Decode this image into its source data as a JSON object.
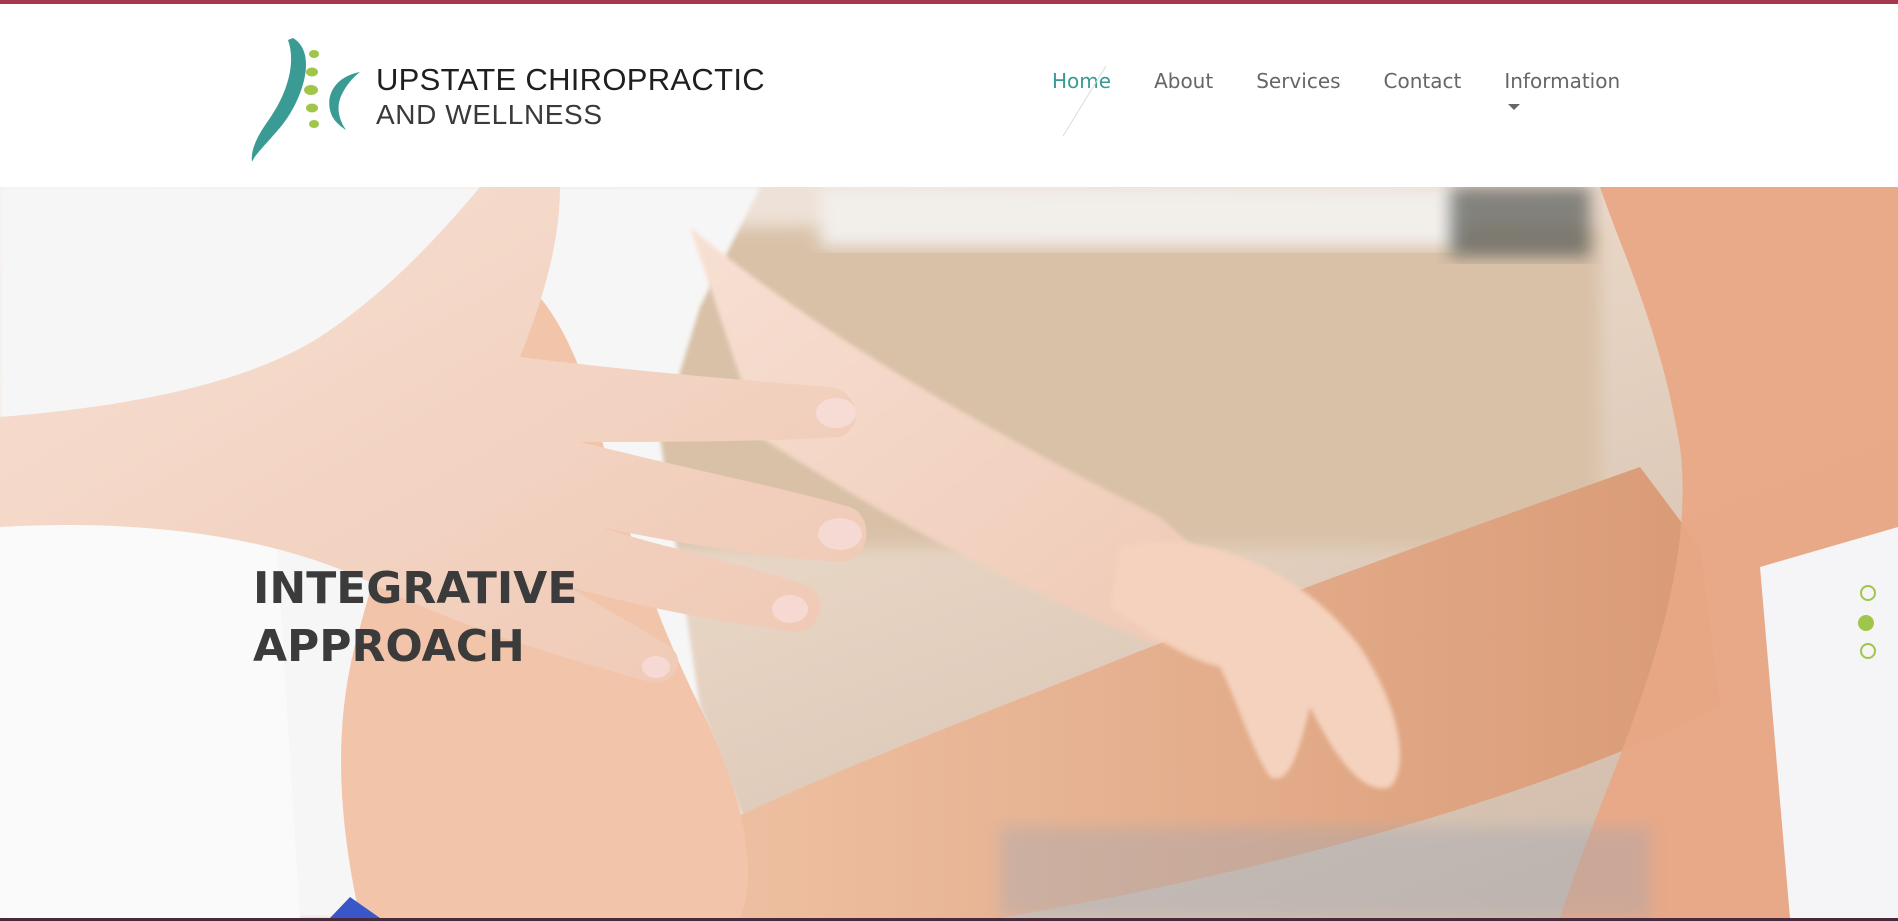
{
  "brand": {
    "line1": "UPSTATE CHIROPRACTIC",
    "line2": "AND WELLNESS",
    "teal": "#3a9a94",
    "green": "#9fc64a",
    "accent_border": "#a6374f"
  },
  "nav": {
    "items": [
      {
        "label": "Home",
        "active": true
      },
      {
        "label": "About",
        "active": false
      },
      {
        "label": "Services",
        "active": false
      },
      {
        "label": "Contact",
        "active": false
      },
      {
        "label": "Information",
        "active": false,
        "has_dropdown": true
      }
    ]
  },
  "hero": {
    "title_line1": "INTEGRATIVE",
    "title_line2": "APPROACH",
    "slides_total": 3,
    "active_slide": 2
  }
}
